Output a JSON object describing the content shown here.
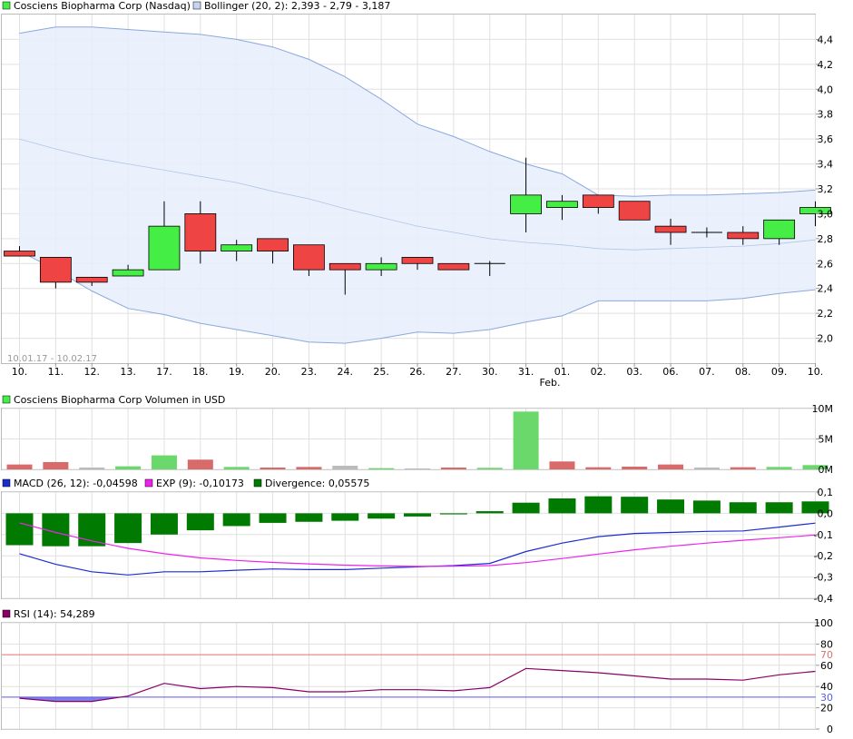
{
  "legends": {
    "price_name": "Cosciens Biopharma Corp (Nasdaq)",
    "bollinger": "Bollinger (20, 2): 2,393 - 2,79 - 3,187",
    "volume": "Cosciens Biopharma Corp Volumen in USD",
    "macd": "MACD (26, 12): -0,04598",
    "exp": "EXP (9): -0,10173",
    "divergence": "Divergence: 0,05575",
    "rsi": "RSI (14): 54,289"
  },
  "colors": {
    "up": "#44ee44",
    "down": "#ee4444",
    "band_fill": "#e8eefc",
    "band_line": "#8aa8dd",
    "macd_line": "#1a2ed0",
    "exp_line": "#ee22ee",
    "divergence": "#007a00",
    "rsi_line": "#880066",
    "rsi_70": "#e07070",
    "rsi_30": "#5a5aee",
    "rsi_fill": "#6a6ae8"
  },
  "date_range": "10.01.17 - 10.02.17",
  "month_label": "Feb.",
  "chart_data": [
    {
      "type": "candlestick",
      "categories": [
        "10.",
        "11.",
        "12.",
        "13.",
        "17.",
        "18.",
        "19.",
        "20.",
        "23.",
        "24.",
        "25.",
        "26.",
        "27.",
        "30.",
        "31.",
        "01.",
        "02.",
        "03.",
        "06.",
        "07.",
        "08.",
        "09.",
        "10."
      ],
      "ohlc": [
        [
          2.7,
          2.74,
          2.66,
          2.66
        ],
        [
          2.65,
          2.65,
          2.4,
          2.45
        ],
        [
          2.49,
          2.49,
          2.42,
          2.45
        ],
        [
          2.5,
          2.59,
          2.5,
          2.55
        ],
        [
          2.55,
          3.1,
          2.55,
          2.9
        ],
        [
          3.0,
          3.1,
          2.6,
          2.7
        ],
        [
          2.7,
          2.79,
          2.62,
          2.75
        ],
        [
          2.8,
          2.8,
          2.6,
          2.7
        ],
        [
          2.75,
          2.75,
          2.5,
          2.55
        ],
        [
          2.6,
          2.6,
          2.35,
          2.55
        ],
        [
          2.55,
          2.65,
          2.5,
          2.6
        ],
        [
          2.65,
          2.65,
          2.55,
          2.6
        ],
        [
          2.6,
          2.6,
          2.55,
          2.55
        ],
        [
          2.6,
          2.62,
          2.5,
          2.6
        ],
        [
          3.0,
          3.45,
          2.85,
          3.15
        ],
        [
          3.05,
          3.15,
          2.95,
          3.1
        ],
        [
          3.15,
          3.15,
          3.0,
          3.05
        ],
        [
          3.1,
          3.1,
          2.95,
          2.95
        ],
        [
          2.9,
          2.96,
          2.75,
          2.85
        ],
        [
          2.85,
          2.89,
          2.81,
          2.85
        ],
        [
          2.85,
          2.9,
          2.75,
          2.8
        ],
        [
          2.8,
          2.95,
          2.75,
          2.95
        ],
        [
          3.0,
          3.1,
          2.9,
          3.05
        ]
      ],
      "bollinger_upper": [
        4.45,
        4.5,
        4.5,
        4.48,
        4.46,
        4.44,
        4.4,
        4.34,
        4.24,
        4.1,
        3.92,
        3.72,
        3.62,
        3.5,
        3.4,
        3.32,
        3.15,
        3.14,
        3.15,
        3.15,
        3.16,
        3.17,
        3.19
      ],
      "bollinger_middle": [
        3.6,
        3.52,
        3.45,
        3.4,
        3.35,
        3.3,
        3.25,
        3.18,
        3.12,
        3.04,
        2.97,
        2.9,
        2.85,
        2.8,
        2.77,
        2.75,
        2.72,
        2.71,
        2.72,
        2.73,
        2.74,
        2.76,
        2.79
      ],
      "bollinger_lower": [
        2.7,
        2.55,
        2.38,
        2.24,
        2.19,
        2.12,
        2.07,
        2.02,
        1.97,
        1.96,
        2.0,
        2.05,
        2.04,
        2.07,
        2.13,
        2.18,
        2.3,
        2.3,
        2.3,
        2.3,
        2.32,
        2.36,
        2.39
      ],
      "ylim": [
        1.8,
        4.6
      ],
      "yticks": [
        "2,0",
        "2,2",
        "2,4",
        "2,6",
        "2,8",
        "3,0",
        "3,2",
        "3,4",
        "3,6",
        "3,8",
        "4,0",
        "4,2",
        "4,4"
      ],
      "ytick_values": [
        2.0,
        2.2,
        2.4,
        2.6,
        2.8,
        3.0,
        3.2,
        3.4,
        3.6,
        3.8,
        4.0,
        4.2,
        4.4
      ],
      "grid": true
    },
    {
      "type": "bar",
      "title": "Cosciens Biopharma Corp Volumen in USD",
      "values_musd": [
        0.8,
        1.2,
        0.3,
        0.5,
        2.3,
        1.6,
        0.4,
        0.3,
        0.4,
        0.6,
        0.2,
        0.15,
        0.3,
        0.25,
        9.5,
        1.3,
        0.35,
        0.45,
        0.8,
        0.3,
        0.35,
        0.4,
        0.7
      ],
      "direction": [
        "down",
        "down",
        "neutral",
        "up",
        "up",
        "down",
        "up",
        "down",
        "down",
        "neutral",
        "up",
        "neutral",
        "down",
        "up",
        "up",
        "down",
        "down",
        "down",
        "down",
        "neutral",
        "down",
        "up",
        "up"
      ],
      "ylim": [
        0,
        10
      ],
      "yticks": [
        "0M",
        "5M",
        "10M"
      ],
      "ytick_values": [
        0,
        5,
        10
      ]
    },
    {
      "type": "line",
      "title": "MACD",
      "macd": [
        -0.19,
        -0.24,
        -0.275,
        -0.29,
        -0.275,
        -0.275,
        -0.268,
        -0.262,
        -0.265,
        -0.265,
        -0.258,
        -0.252,
        -0.246,
        -0.236,
        -0.18,
        -0.14,
        -0.11,
        -0.095,
        -0.09,
        -0.085,
        -0.083,
        -0.065,
        -0.046
      ],
      "exp": [
        -0.045,
        -0.09,
        -0.13,
        -0.165,
        -0.19,
        -0.21,
        -0.222,
        -0.231,
        -0.238,
        -0.244,
        -0.248,
        -0.25,
        -0.249,
        -0.246,
        -0.232,
        -0.213,
        -0.192,
        -0.172,
        -0.155,
        -0.14,
        -0.127,
        -0.115,
        -0.102
      ],
      "divergence": [
        -0.15,
        -0.155,
        -0.155,
        -0.14,
        -0.1,
        -0.08,
        -0.06,
        -0.045,
        -0.04,
        -0.035,
        -0.025,
        -0.015,
        -0.005,
        0.01,
        0.05,
        0.07,
        0.08,
        0.078,
        0.065,
        0.06,
        0.052,
        0.052,
        0.056
      ],
      "ylim": [
        -0.4,
        0.1
      ],
      "yticks": [
        "-0,4",
        "-0,3",
        "-0,2",
        "-0,1",
        "0,0",
        "0,1"
      ],
      "ytick_values": [
        -0.4,
        -0.3,
        -0.2,
        -0.1,
        0.0,
        0.1
      ]
    },
    {
      "type": "line",
      "title": "RSI (14)",
      "values": [
        29,
        26,
        26,
        31,
        43,
        38,
        40,
        39,
        35,
        35,
        37,
        37,
        36,
        39,
        57,
        55,
        53,
        50,
        47,
        47,
        46,
        51,
        54.3
      ],
      "levels": [
        70,
        30
      ],
      "ylim": [
        0,
        100
      ],
      "yticks": [
        "0",
        "20",
        "40",
        "60",
        "80",
        "100"
      ],
      "ytick_values": [
        0,
        20,
        40,
        60,
        80,
        100
      ],
      "level_labels": [
        "70",
        "30"
      ]
    }
  ]
}
